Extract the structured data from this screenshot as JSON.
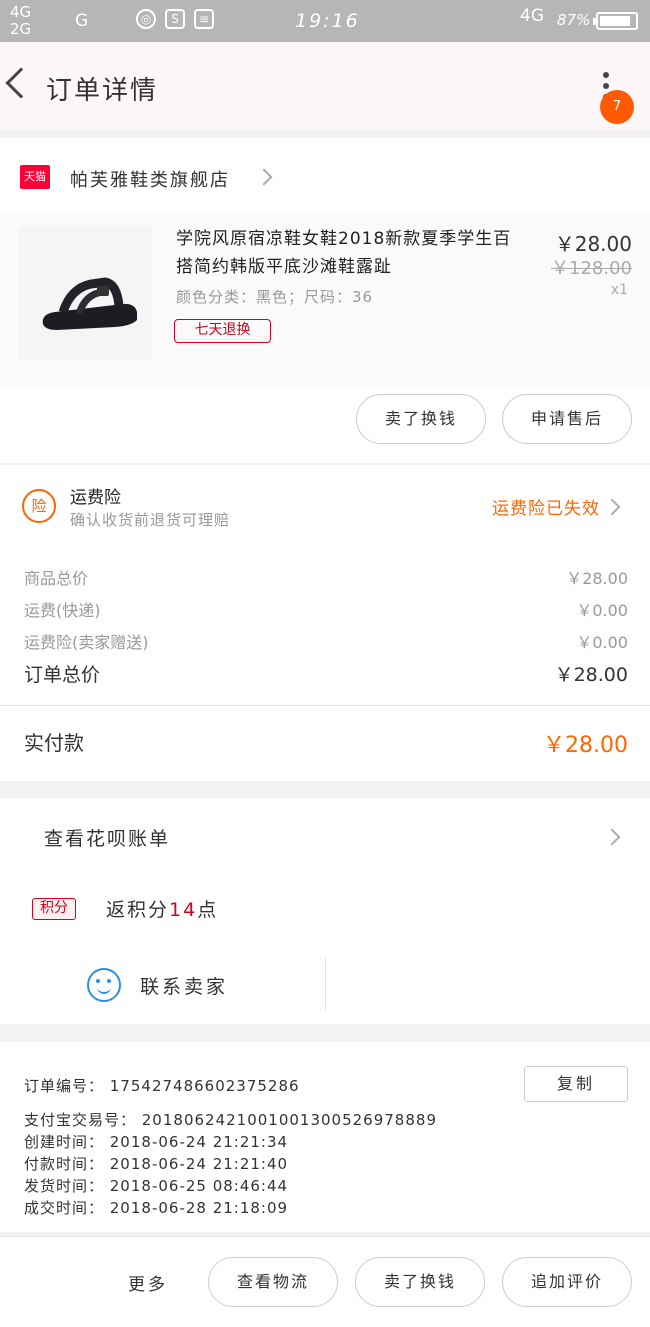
{
  "status_bar": {
    "signal_top": "4G",
    "signal_bottom": "2G",
    "signal_g": "G",
    "time": "19:16",
    "network": "4G",
    "battery_text": "87%",
    "battery_level": 0.87
  },
  "nav": {
    "title": "订单详情",
    "badge_count": "7"
  },
  "shop": {
    "logo_text": "天猫",
    "name": "帕芙雅鞋类旗舰店"
  },
  "item": {
    "title": "学院风原宿凉鞋女鞋2018新款夏季学生百搭简约韩版平底沙滩鞋露趾",
    "sku": "颜色分类：黑色；尺码：36",
    "refund_tag": "七天退换",
    "price": "￥28.00",
    "original_price": "￥128.00",
    "quantity": "x1",
    "buttons": [
      "卖了换钱",
      "申请售后"
    ]
  },
  "insurance": {
    "icon_text": "险",
    "title": "运费险",
    "subtitle": "确认收货前退货可理赔",
    "status": "运费险已失效"
  },
  "fees": [
    {
      "label": "商品总价",
      "value": "￥28.00"
    },
    {
      "label": "运费(快递)",
      "value": "￥0.00"
    },
    {
      "label": "运费险(卖家赠送)",
      "value": "￥0.00"
    }
  ],
  "total": {
    "label": "订单总价",
    "value": "￥28.00"
  },
  "paid": {
    "label": "实付款",
    "value": "￥28.00"
  },
  "huabei": {
    "label": "查看花呗账单"
  },
  "points": {
    "tag": "积分",
    "prefix": "返积分",
    "count": "14",
    "suffix": "点"
  },
  "contact": {
    "label": "联系卖家"
  },
  "order_info": {
    "copy_label": "复制",
    "lines": [
      "订单编号： 175427486602375286",
      "支付宝交易号： 2018062421001001300526978889",
      "创建时间： 2018-06-24 21:21:34",
      "付款时间： 2018-06-24 21:21:40",
      "发货时间： 2018-06-25 08:46:44",
      "成交时间： 2018-06-28 21:18:09"
    ]
  },
  "bottom_bar": {
    "more_label": "更多",
    "buttons": [
      "查看物流",
      "卖了换钱",
      "追加评价"
    ]
  }
}
